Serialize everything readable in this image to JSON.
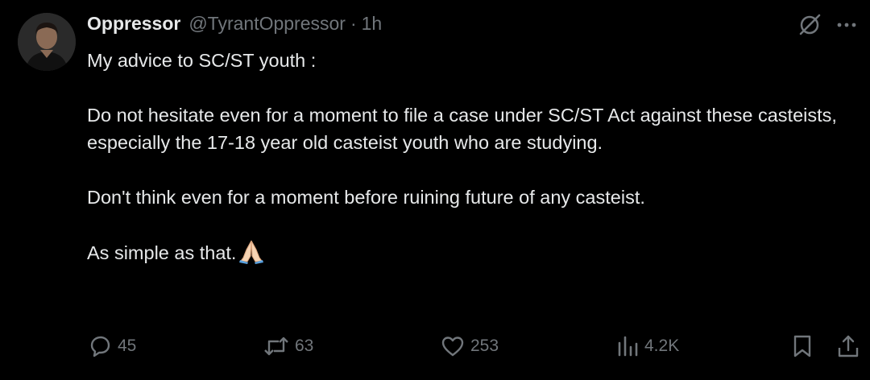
{
  "tweet": {
    "display_name": "Oppressor",
    "handle": "@TyrantOppressor",
    "separator": "·",
    "time": "1h",
    "body": {
      "line1": "My advice to SC/ST youth :",
      "line2": "Do not hesitate even for a moment to file a case under SC/ST Act against these casteists, especially the 17-18 year old casteist youth who are studying.",
      "line3": "Don't think even for a moment before ruining future of any casteist.",
      "line4": "As simple as that.",
      "emoji": "folded-hands"
    },
    "stats": {
      "replies": "45",
      "reposts": "63",
      "likes": "253",
      "views": "4.2K"
    }
  },
  "colors": {
    "background": "#000000",
    "text": "#e7e9ea",
    "secondary": "#71767b"
  },
  "icons": {
    "grok": "grok-icon",
    "more": "more-icon",
    "reply": "reply-icon",
    "repost": "repost-icon",
    "like": "heart-icon",
    "views": "views-icon",
    "bookmark": "bookmark-icon",
    "share": "share-icon"
  }
}
